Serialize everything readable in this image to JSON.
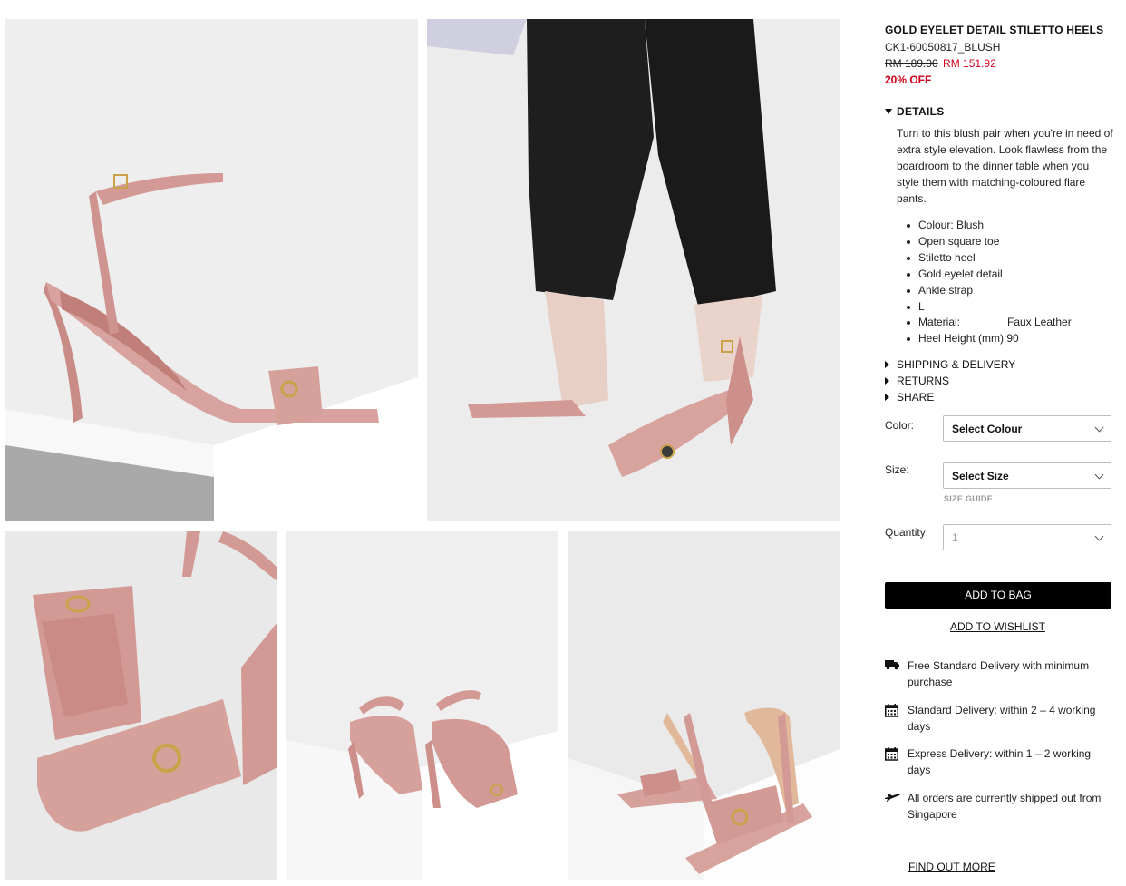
{
  "product": {
    "title": "GOLD EYELET DETAIL STILETTO HEELS",
    "sku": "CK1-60050817_BLUSH",
    "old_price": "RM 189.90",
    "new_price": "RM 151.92",
    "discount": "20% OFF"
  },
  "details": {
    "heading": "DETAILS",
    "description": "Turn to this blush pair when you're in need of extra style elevation. Look flawless from the boardroom to the dinner table when you style them with matching-coloured flare pants.",
    "bullets": [
      "Colour: Blush",
      "Open square toe",
      "Stiletto heel",
      "Gold eyelet detail",
      "Ankle strap",
      "L"
    ],
    "material_label": "Material:",
    "material_value": "Faux Leather",
    "heel_label": "Heel Height (mm):",
    "heel_value": "90"
  },
  "accordions": {
    "shipping": "SHIPPING & DELIVERY",
    "returns": "RETURNS",
    "share": "SHARE"
  },
  "form": {
    "color_label": "Color:",
    "color_value": "Select Colour",
    "size_label": "Size:",
    "size_value": "Select Size",
    "size_guide": "SIZE GUIDE",
    "quantity_label": "Quantity:",
    "quantity_value": "1"
  },
  "actions": {
    "add_to_bag": "ADD TO BAG",
    "add_to_wishlist": "ADD TO WISHLIST"
  },
  "delivery_info": [
    {
      "icon": "truck-icon",
      "text": "Free Standard Delivery with minimum purchase"
    },
    {
      "icon": "calendar-icon",
      "text": "Standard Delivery: within 2 – 4 working days"
    },
    {
      "icon": "calendar-icon",
      "text": "Express Delivery: within 1 – 2 working days"
    },
    {
      "icon": "airplane-icon",
      "text": "All orders are currently shipped out from Singapore"
    }
  ],
  "find_out_more": "FIND OUT MORE",
  "colors": {
    "sale_red": "#d0021b",
    "button_black": "#000000",
    "shoe_blush": "#d39a95"
  }
}
